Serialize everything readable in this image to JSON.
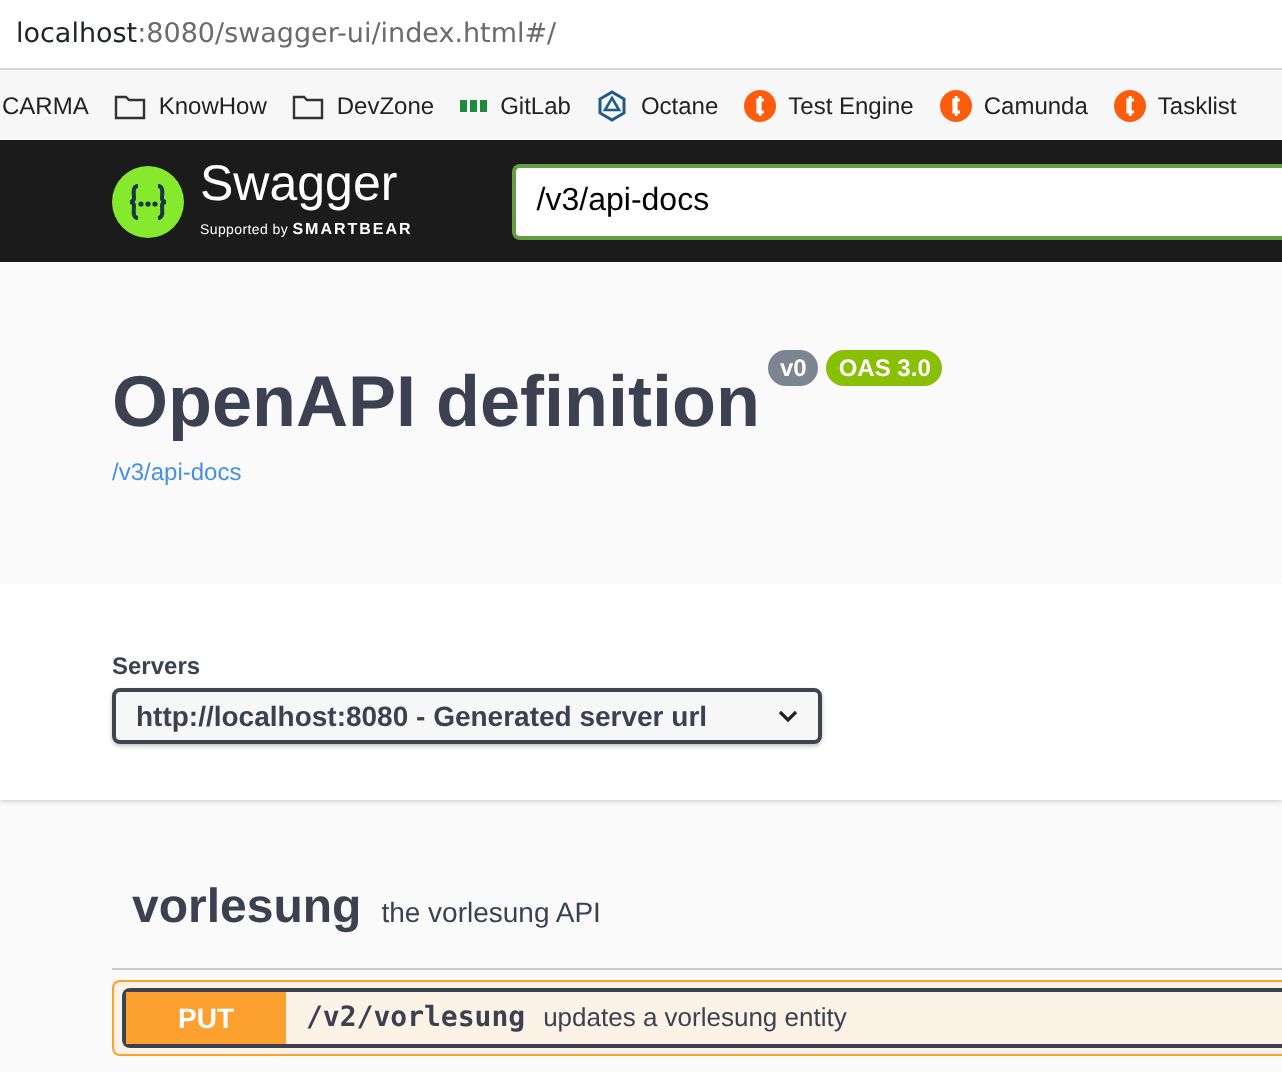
{
  "address_bar": {
    "host": "localhost",
    "path": ":8080/swagger-ui/index.html#/"
  },
  "bookmarks": [
    {
      "label": "CARMA",
      "kind": "none"
    },
    {
      "label": "KnowHow",
      "kind": "folder"
    },
    {
      "label": "DevZone",
      "kind": "folder"
    },
    {
      "label": "GitLab",
      "kind": "gitlab"
    },
    {
      "label": "Octane",
      "kind": "octane"
    },
    {
      "label": "Test Engine",
      "kind": "camunda"
    },
    {
      "label": "Camunda",
      "kind": "camunda"
    },
    {
      "label": "Tasklist",
      "kind": "camunda"
    }
  ],
  "topbar": {
    "logo_text": "Swagger",
    "logo_tagline": "Supported by",
    "logo_brand": "SMARTBEAR",
    "search_value": "/v3/api-docs"
  },
  "info": {
    "title": "OpenAPI definition",
    "version": "v0",
    "oas": "OAS 3.0",
    "url": "/v3/api-docs"
  },
  "servers": {
    "label": "Servers",
    "selected": "http://localhost:8080 - Generated server url"
  },
  "tags": [
    {
      "name": "vorlesung",
      "description": "the vorlesung API",
      "operations": [
        {
          "method": "PUT",
          "path": "/v2/vorlesung",
          "summary": "updates a vorlesung entity",
          "focused": true
        }
      ]
    }
  ]
}
